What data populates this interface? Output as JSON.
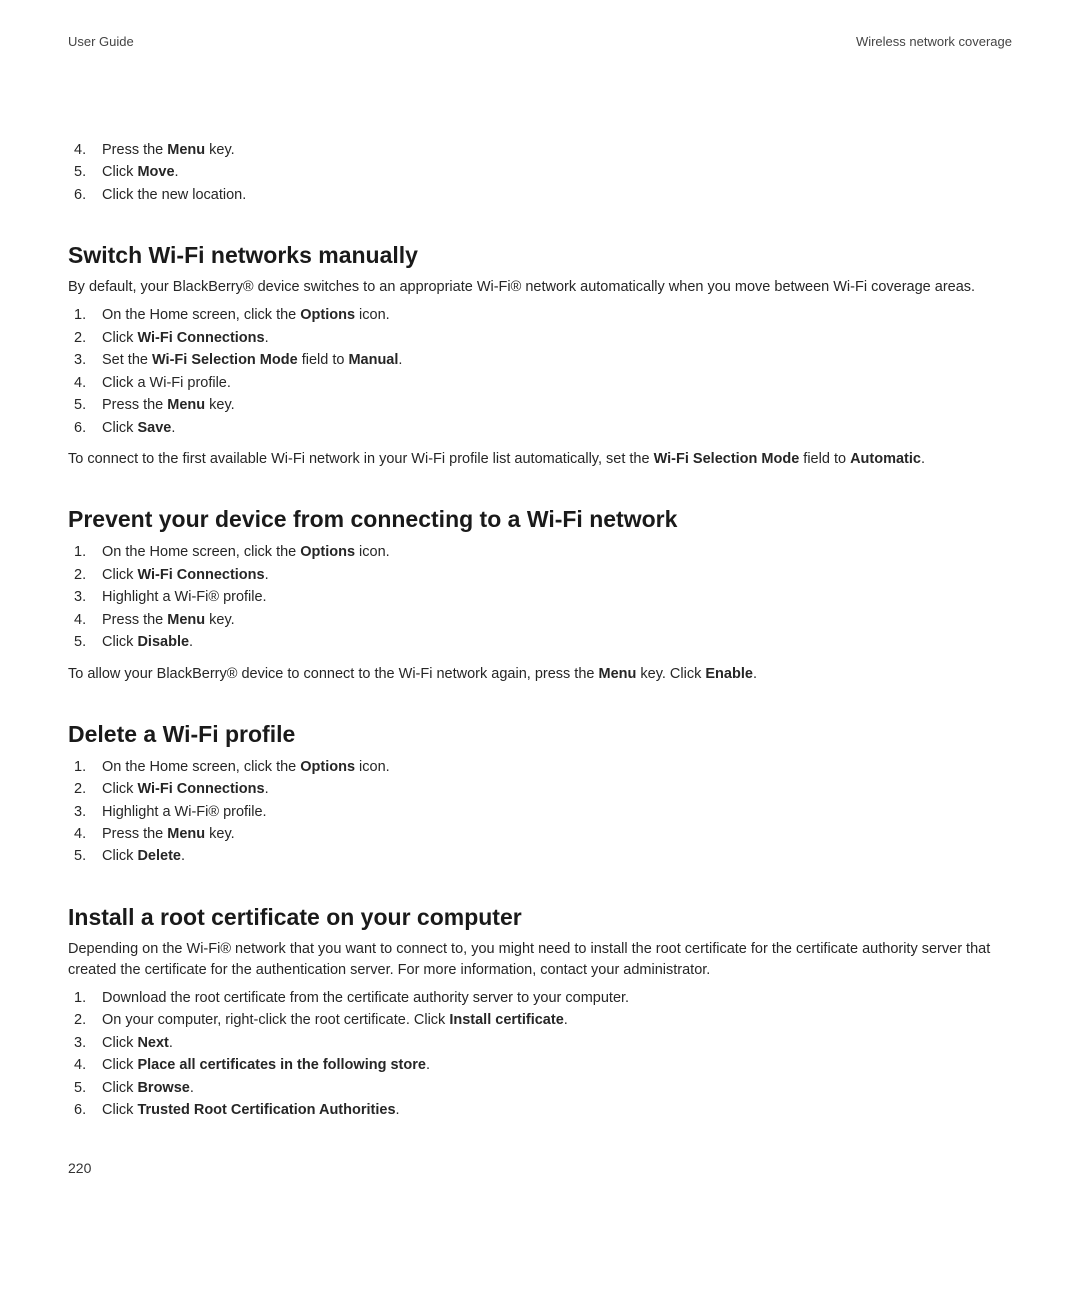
{
  "header": {
    "left": "User Guide",
    "right": "Wireless network coverage"
  },
  "intro_steps": [
    {
      "n": "4.",
      "pre": "Press the ",
      "bold": "Menu",
      "post": " key."
    },
    {
      "n": "5.",
      "pre": "Click ",
      "bold": "Move",
      "post": "."
    },
    {
      "n": "6.",
      "pre": "Click the new location.",
      "bold": "",
      "post": ""
    }
  ],
  "sec_switch": {
    "title": "Switch Wi-Fi networks manually",
    "intro": "By default, your BlackBerry® device switches to an appropriate Wi-Fi® network automatically when you move between Wi-Fi coverage areas.",
    "steps": [
      {
        "n": "1.",
        "pre": "On the Home screen, click the ",
        "bold": "Options",
        "post": " icon."
      },
      {
        "n": "2.",
        "pre": "Click ",
        "bold": "Wi-Fi Connections",
        "post": "."
      },
      {
        "n": "3.",
        "pre": "Set the ",
        "bold": "Wi-Fi Selection Mode",
        "post_pre": " field to ",
        "bold2": "Manual",
        "post": "."
      },
      {
        "n": "4.",
        "pre": "Click a Wi-Fi profile.",
        "bold": "",
        "post": ""
      },
      {
        "n": "5.",
        "pre": "Press the ",
        "bold": "Menu",
        "post": " key."
      },
      {
        "n": "6.",
        "pre": "Click ",
        "bold": "Save",
        "post": "."
      }
    ],
    "tail_pre": "To connect to the first available Wi-Fi network in your Wi-Fi profile list automatically, set the ",
    "tail_bold1": "Wi-Fi Selection Mode",
    "tail_mid": " field to ",
    "tail_bold2": "Automatic",
    "tail_post": "."
  },
  "sec_prevent": {
    "title": "Prevent your device from connecting to a Wi-Fi network",
    "steps": [
      {
        "n": "1.",
        "pre": "On the Home screen, click the ",
        "bold": "Options",
        "post": " icon."
      },
      {
        "n": "2.",
        "pre": "Click ",
        "bold": "Wi-Fi Connections",
        "post": "."
      },
      {
        "n": "3.",
        "pre": "Highlight a Wi-Fi® profile.",
        "bold": "",
        "post": ""
      },
      {
        "n": "4.",
        "pre": "Press the ",
        "bold": "Menu",
        "post": " key."
      },
      {
        "n": "5.",
        "pre": "Click ",
        "bold": "Disable",
        "post": "."
      }
    ],
    "tail_pre": "To allow your BlackBerry® device to connect to the Wi-Fi network again, press the ",
    "tail_bold1": "Menu",
    "tail_mid": " key. Click ",
    "tail_bold2": "Enable",
    "tail_post": "."
  },
  "sec_delete": {
    "title": "Delete a Wi-Fi profile",
    "steps": [
      {
        "n": "1.",
        "pre": "On the Home screen, click the ",
        "bold": "Options",
        "post": " icon."
      },
      {
        "n": "2.",
        "pre": "Click ",
        "bold": "Wi-Fi Connections",
        "post": "."
      },
      {
        "n": "3.",
        "pre": "Highlight a Wi-Fi® profile.",
        "bold": "",
        "post": ""
      },
      {
        "n": "4.",
        "pre": "Press the ",
        "bold": "Menu",
        "post": " key."
      },
      {
        "n": "5.",
        "pre": "Click ",
        "bold": "Delete",
        "post": "."
      }
    ]
  },
  "sec_install": {
    "title": "Install a root certificate on your computer",
    "intro": "Depending on the Wi-Fi® network that you want to connect to, you might need to install the root certificate for the certificate authority server that created the certificate for the authentication server. For more information, contact your administrator.",
    "steps": [
      {
        "n": "1.",
        "pre": "Download the root certificate from the certificate authority server to your computer.",
        "bold": "",
        "post": ""
      },
      {
        "n": "2.",
        "pre": "On your computer, right-click the root certificate. Click ",
        "bold": "Install certificate",
        "post": "."
      },
      {
        "n": "3.",
        "pre": "Click ",
        "bold": "Next",
        "post": "."
      },
      {
        "n": "4.",
        "pre": "Click ",
        "bold": "Place all certificates in the following store",
        "post": "."
      },
      {
        "n": "5.",
        "pre": "Click ",
        "bold": "Browse",
        "post": "."
      },
      {
        "n": "6.",
        "pre": "Click ",
        "bold": "Trusted Root Certification Authorities",
        "post": "."
      }
    ]
  },
  "page_number": "220"
}
